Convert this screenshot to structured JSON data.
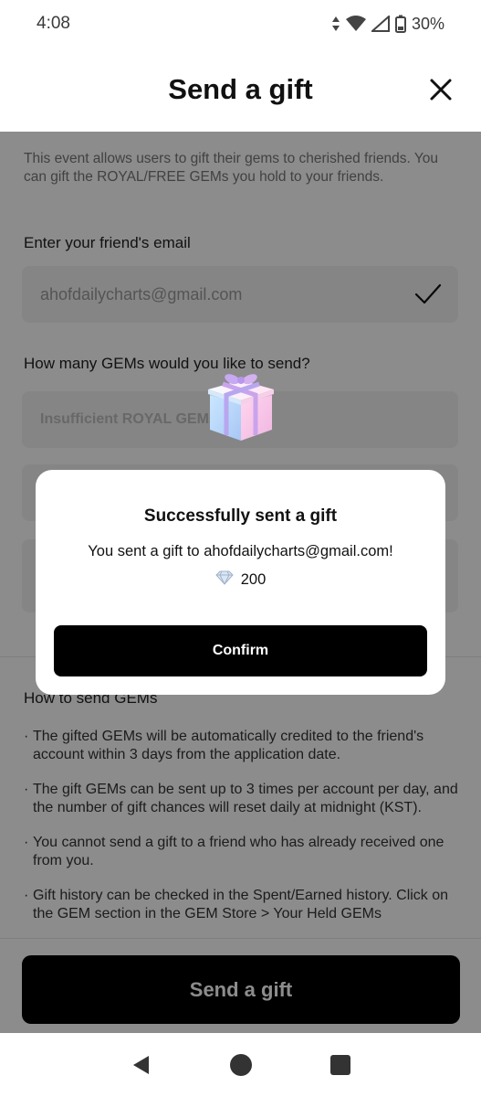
{
  "status_bar": {
    "time": "4:08",
    "battery": "30%"
  },
  "header": {
    "title": "Send a gift"
  },
  "content": {
    "intro": "This event allows users to gift their gems to cherished friends. You can gift the ROYAL/FREE GEMs you hold to your friends.",
    "email_label": "Enter your friend's email",
    "email_value": "ahofdailycharts@gmail.com",
    "gems_label": "How many GEMs would you like to send?",
    "royal_field_text": "Insufficient ROYAL GEMs",
    "howto_title": "How to send GEMs",
    "notes": [
      "The gifted GEMs will be automatically credited to the friend's account within 3 days from the application date.",
      "The gift GEMs can be sent up to 3 times per account per day, and the number of gift chances will reset daily at midnight (KST).",
      "You cannot send a gift to a friend who has already received one from you.",
      "Gift history can be checked in the Spent/Earned history. Click on the GEM section in the GEM Store > Your Held GEMs"
    ]
  },
  "footer": {
    "send_button": "Send a gift"
  },
  "modal": {
    "title": "Successfully sent a gift",
    "message": "You sent a gift to ahofdailycharts@gmail.com!",
    "amount": "200",
    "confirm_button": "Confirm"
  },
  "icons": {
    "close": "close-icon",
    "check": "check-icon",
    "gift": "gift-icon",
    "gem": "gem-icon"
  },
  "colors": {
    "primary_button": "#000000",
    "overlay": "rgba(0,0,0,0.45)"
  }
}
